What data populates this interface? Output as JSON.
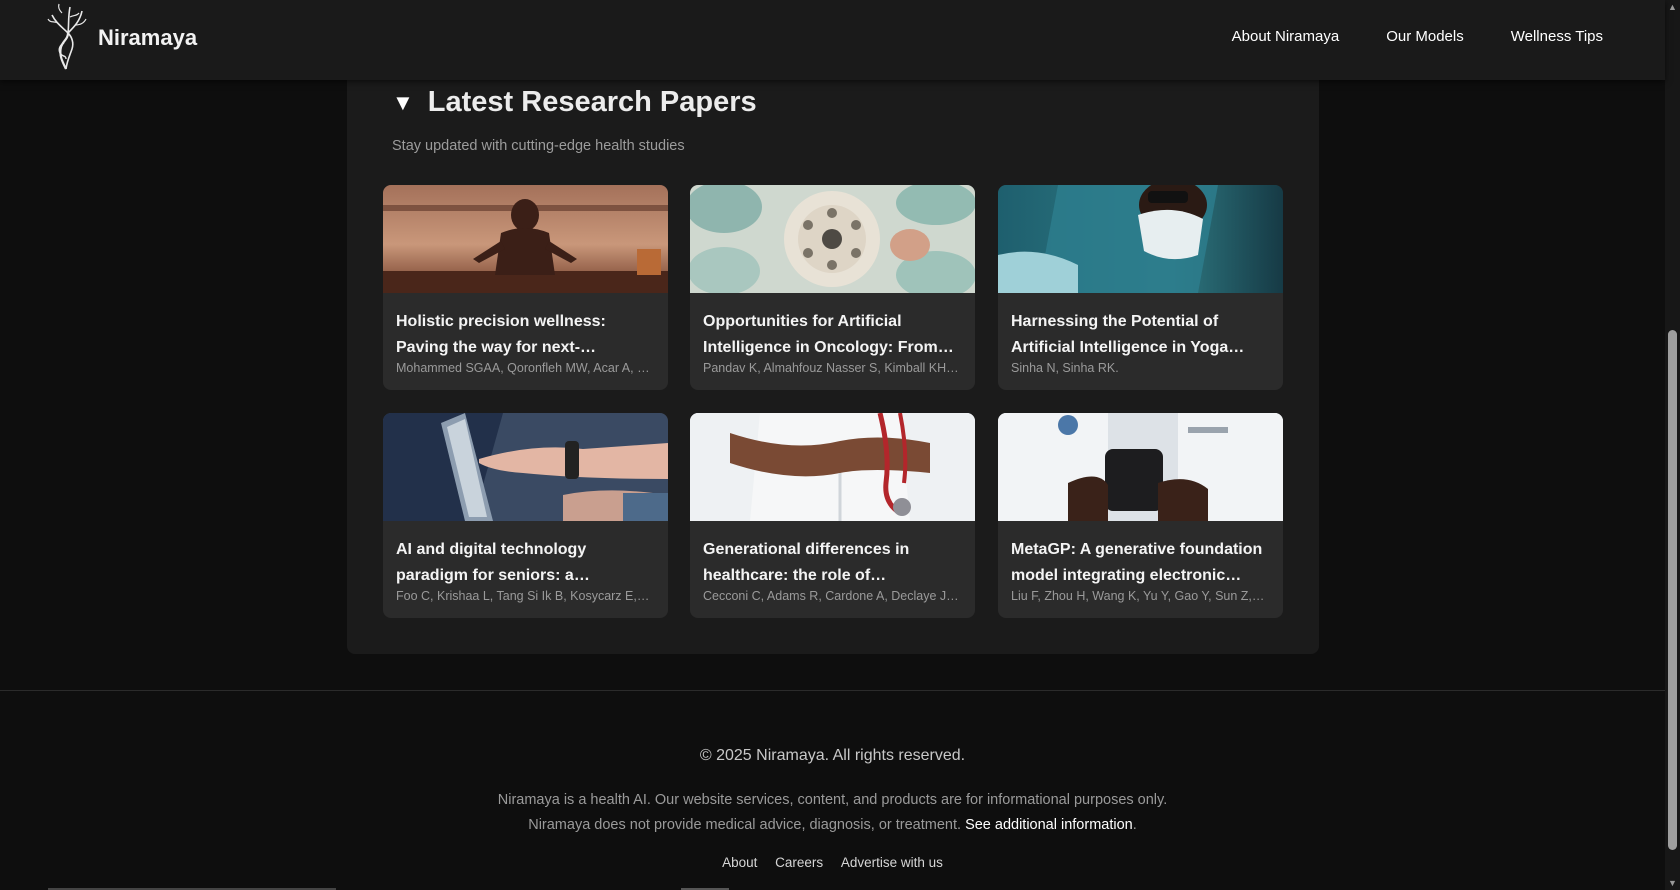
{
  "header": {
    "brand": "Niramaya",
    "nav": [
      {
        "label": "About Niramaya"
      },
      {
        "label": "Our Models"
      },
      {
        "label": "Wellness Tips"
      }
    ]
  },
  "research": {
    "caret": "▼",
    "title": "Latest Research Papers",
    "subtitle": "Stay updated with cutting-edge health studies",
    "papers": [
      {
        "title": "Holistic precision wellness: Paving the way for next-…",
        "authors": "Mohammed SGAA, Qoronfleh MW, Acar A, …",
        "image": "meditation-photo"
      },
      {
        "title": "Opportunities for Artificial Intelligence in Oncology: From…",
        "authors": "Pandav K, Almahfouz Nasser S, Kimball KH…",
        "image": "surgeons-operating-light-photo"
      },
      {
        "title": "Harnessing the Potential of Artificial Intelligence in Yoga…",
        "authors": "Sinha N, Sinha RK.",
        "image": "surgeon-mask-photo"
      },
      {
        "title": "AI and digital technology paradigm for seniors: a…",
        "authors": "Foo C, Krishaa L, Tang Si Ik B, Kosycarz E,…",
        "image": "tablet-smartwatch-photo"
      },
      {
        "title": "Generational differences in healthcare: the role of…",
        "authors": "Cecconi C, Adams R, Cardone A, Declaye J…",
        "image": "doctor-stethoscope-photo"
      },
      {
        "title": "MetaGP: A generative foundation model integrating electronic…",
        "authors": "Liu F, Zhou H, Wang K, Yu Y, Gao Y, Sun Z,…",
        "image": "doctor-smartphone-photo"
      }
    ]
  },
  "footer": {
    "copyright": "© 2025 Niramaya. All rights reserved.",
    "disclaimer_line1": "Niramaya is a health AI. Our website services, content, and products are for informational purposes only.",
    "disclaimer_line2": "Niramaya does not provide medical advice, diagnosis, or treatment.",
    "disclaimer_link": "See additional information",
    "disclaimer_end": ".",
    "links": [
      {
        "label": "About"
      },
      {
        "label": "Careers"
      },
      {
        "label": "Advertise with us"
      }
    ]
  },
  "colors": {
    "background": "#0e0e0e",
    "header": "#1a1a1a",
    "section": "#1b1b1b",
    "card": "#2b2b2b",
    "muted_text": "#9a9a9a"
  }
}
